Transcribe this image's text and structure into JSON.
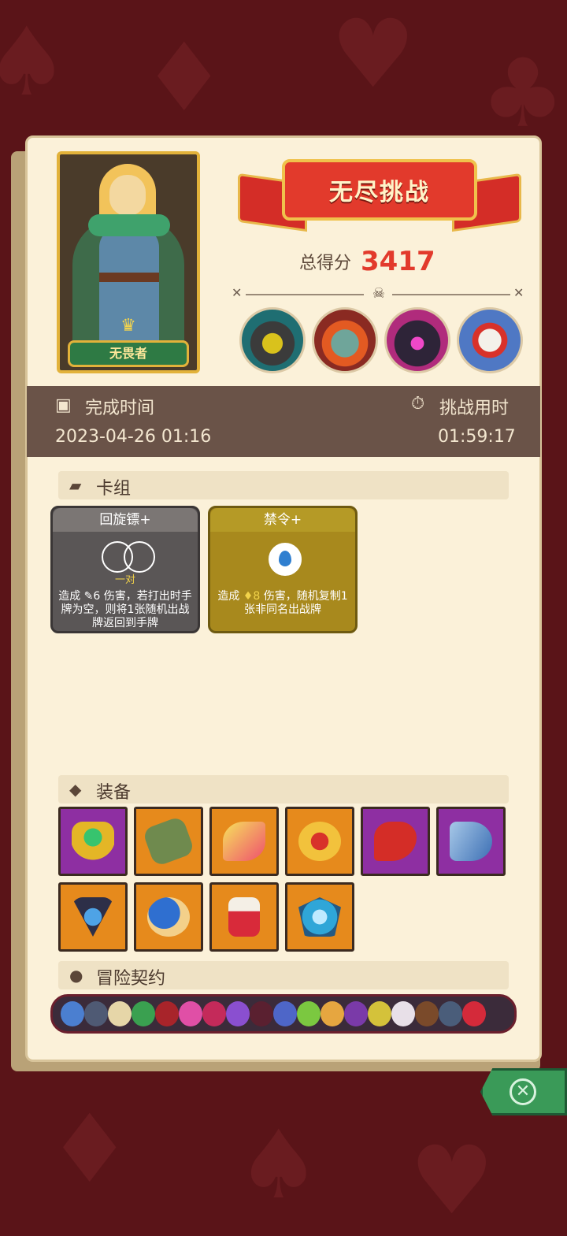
{
  "hero": {
    "name": "无畏者"
  },
  "header": {
    "title": "无尽挑战",
    "score_label": "总得分",
    "score_value": "3417"
  },
  "bosses": [
    {
      "icon": "knight-helmet-boss-icon"
    },
    {
      "icon": "orc-boss-icon"
    },
    {
      "icon": "shadow-demon-boss-icon"
    },
    {
      "icon": "bone-dragon-boss-icon"
    }
  ],
  "times": {
    "finish_label": "完成时间",
    "finish_value": "2023-04-26 01:16",
    "duration_label": "挑战用时",
    "duration_value": "01:59:17"
  },
  "deck": {
    "section_title": "卡组",
    "cards": [
      {
        "name": "回旋镖+",
        "tag": "一对",
        "desc_prefix": "造成",
        "damage": "6",
        "desc_suffix": "伤害，若打出时手牌为空，则将1张随机出战牌返回到手牌"
      },
      {
        "name": "禁令+",
        "tag": "",
        "desc_prefix": "造成",
        "damage": "8",
        "desc_suffix": "伤害，随机复制1张非同名出战牌"
      }
    ]
  },
  "equipment": {
    "section_title": "装备",
    "items": [
      {
        "icon": "emerald-ring-icon",
        "rarity_color": "#8e2fa2"
      },
      {
        "icon": "mossy-stone-icon",
        "rarity_color": "#e68a1c"
      },
      {
        "icon": "fire-feather-icon",
        "rarity_color": "#e68a1c"
      },
      {
        "icon": "golden-crown-icon",
        "rarity_color": "#e68a1c"
      },
      {
        "icon": "red-dagger-icon",
        "rarity_color": "#8e2fa2"
      },
      {
        "icon": "blue-horn-icon",
        "rarity_color": "#8e2fa2"
      },
      {
        "icon": "hexagram-pendant-icon",
        "rarity_color": "#e68a1c"
      },
      {
        "icon": "blue-mushroom-icon",
        "rarity_color": "#e68a1c"
      },
      {
        "icon": "red-potion-jar-icon",
        "rarity_color": "#e68a1c"
      },
      {
        "icon": "blue-crystal-shield-icon",
        "rarity_color": "#e68a1c"
      }
    ]
  },
  "contracts": {
    "section_title": "冒险契约",
    "items": [
      "mushroom-icon",
      "hook-icon",
      "bone-icon",
      "green-hat-icon",
      "red-hat-icon",
      "pink-gear-icon",
      "heart-icon",
      "purple-shield-icon",
      "fang-mouth-icon",
      "blue-wizard-icon",
      "green-eye-icon",
      "horn-icon",
      "purple-rune-icon",
      "snake-icon",
      "cross-badge-icon",
      "brown-stone-icon",
      "fist-shield-icon",
      "red-demon-icon"
    ]
  }
}
